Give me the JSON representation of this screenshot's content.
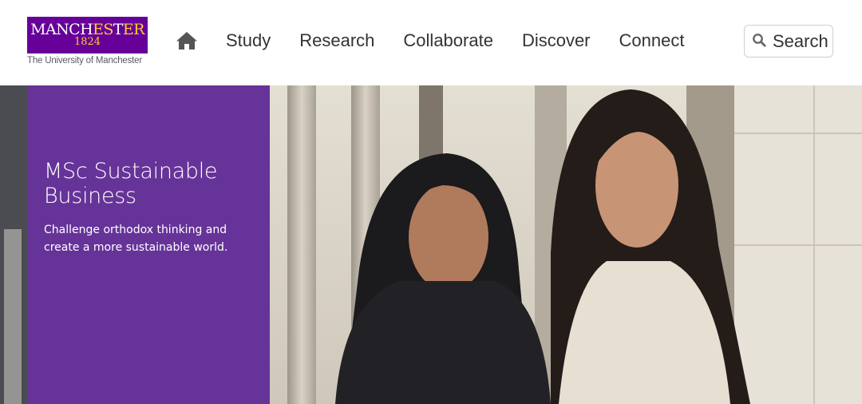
{
  "logo": {
    "name_part1": "MANCH",
    "name_part2": "ES",
    "name_part3": "T",
    "name_part4": "ER",
    "year": "1824",
    "subtitle": "The University of Manchester",
    "colors": {
      "background": "#660099",
      "accent": "#ffcc33"
    }
  },
  "header": {
    "home_icon": "home-icon",
    "nav": [
      {
        "label": "Study"
      },
      {
        "label": "Research"
      },
      {
        "label": "Collaborate"
      },
      {
        "label": "Discover"
      },
      {
        "label": "Connect"
      }
    ],
    "search": {
      "label": "Search",
      "icon": "search-icon"
    }
  },
  "hero": {
    "title": "MSc Sustainable Business",
    "description": "Challenge orthodox thinking and create a more sustainable world.",
    "panel_color": "#663399"
  }
}
